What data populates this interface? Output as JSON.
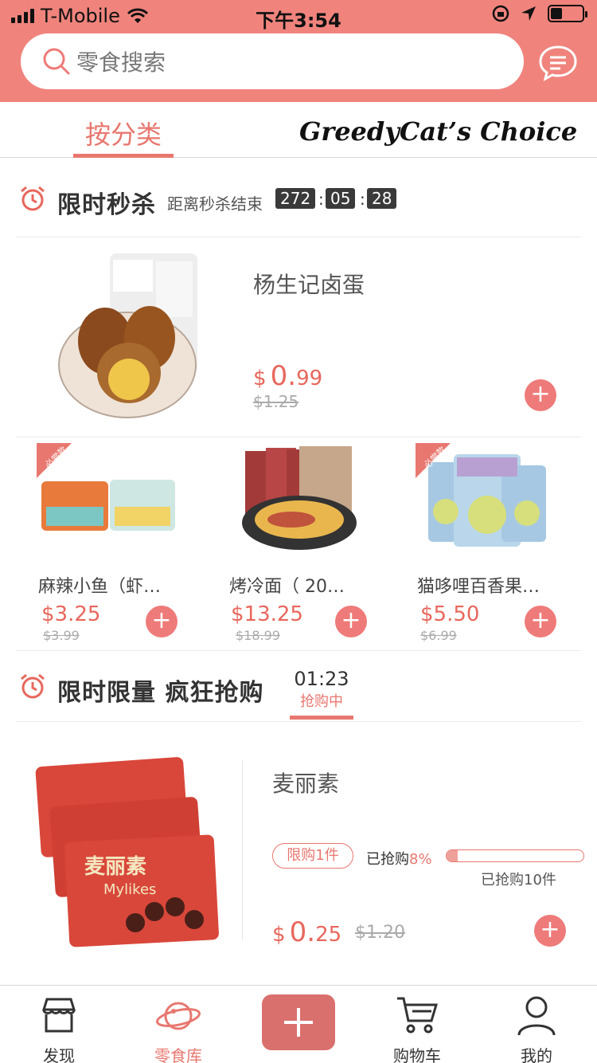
{
  "status_bar": {
    "carrier": "T-Mobile",
    "time": "下午3:54"
  },
  "search": {
    "placeholder": "零食搜索"
  },
  "tabs": [
    {
      "label": "按分类",
      "active": true
    },
    {
      "label": "GreedyCat’s Choice",
      "active": false
    }
  ],
  "flash_sale": {
    "title": "限时秒杀",
    "countdown_label": "距离秒杀结束",
    "countdown": [
      "272",
      "05",
      "28"
    ],
    "featured": {
      "name": "杨生记卤蛋",
      "price_symbol": "$",
      "price_int": "0.",
      "price_dec": "99",
      "old_price": "$1.25"
    },
    "items": [
      {
        "name": "麻辣小鱼（虾…",
        "price": "$3.25",
        "old_price": "$3.99",
        "badge": "必尝款"
      },
      {
        "name": "烤冷面（ 20…",
        "price": "$13.25",
        "old_price": "$18.99"
      },
      {
        "name": "猫哆哩百香果…",
        "price": "$5.50",
        "old_price": "$6.99",
        "badge": "必尝款"
      }
    ]
  },
  "limited": {
    "title": "限时限量 疯狂抢购",
    "tab_time": "01:23",
    "tab_status": "抢购中",
    "product": {
      "name": "麦丽素",
      "limit": "限购1件",
      "sold_label": "已抢购",
      "sold_percent_text": "8%",
      "sold_percent": 8,
      "sold_count": "已抢购10件",
      "price_symbol": "$",
      "price_int": "0.",
      "price_dec": "25",
      "old_price": "$1.20"
    }
  },
  "nav": [
    {
      "label": "发现",
      "icon": "store-icon"
    },
    {
      "label": "零食库",
      "icon": "planet-icon",
      "active": true
    },
    {
      "label": "",
      "icon": "plus-icon"
    },
    {
      "label": "购物车",
      "icon": "cart-icon"
    },
    {
      "label": "我的",
      "icon": "person-icon"
    }
  ],
  "colors": {
    "accent": "#f0847d",
    "price": "#e8675c",
    "plus": "#ee7b79"
  }
}
